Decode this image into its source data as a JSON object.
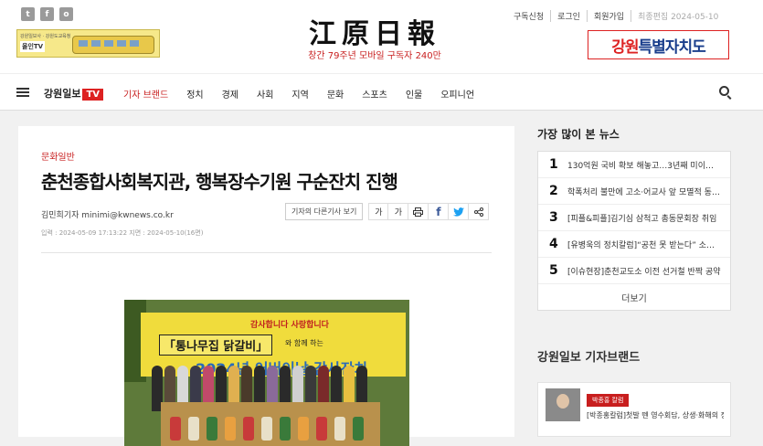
{
  "header": {
    "social": [
      "t",
      "f",
      "o"
    ],
    "logo": "江原日報",
    "tagline": "창간 79주년 모바일 구독자 240만",
    "util": {
      "subscribe": "구독신청",
      "login": "로그인",
      "join": "회원가입",
      "updated": "최종편집 2024-05-10"
    },
    "ad_left": {
      "small": "강원일보사 · 강원도교육청",
      "tag": "올인TV"
    },
    "ad_right": {
      "lead": "강원",
      "rest": "특별자치도"
    }
  },
  "nav": {
    "brand": "강원일보",
    "brand_tv": "TV",
    "items": [
      "기자 브랜드",
      "정치",
      "경제",
      "사회",
      "지역",
      "문화",
      "스포츠",
      "인물",
      "오피니언"
    ]
  },
  "article": {
    "section": "문화일반",
    "title": "춘천종합사회복지관, 행복장수기원 구순잔치 진행",
    "byline": "김민희기자 minimi@kwnews.co.kr",
    "other_articles": "기자의 다른기사 보기",
    "font_smaller": "가",
    "font_larger": "가",
    "meta": "입력 : 2024-05-09 17:13:22 지면 : 2024-05-10(16면)",
    "photo": {
      "banner_top": "감사합니다  사랑합니다",
      "banner_name": "「통나무집 닭갈비」",
      "banner_with": "와 함께 하는",
      "banner_year": "2024년 어버이날 감사잔치"
    }
  },
  "sidebar": {
    "popular_title": "가장 많이 본 뉴스",
    "popular": [
      {
        "rank": "1",
        "title": "130억원 국비 확보 해놓고…3년째 미이뤄진 사업"
      },
      {
        "rank": "2",
        "title": "학폭처리 불만에 고소·어교사 앞 모멸적 동영상"
      },
      {
        "rank": "3",
        "title": "[피플&피플]김기심 삼척고 총동문회장 취임"
      },
      {
        "rank": "4",
        "title": "[유병욱의 정치칼럼]“공천 못 받는다” 소문에"
      },
      {
        "rank": "5",
        "title": "[이슈현장]춘천교도소 이전 선거철 반짝 공약"
      }
    ],
    "more": "더보기",
    "brand_title": "강원일보 기자브랜드",
    "reporter": {
      "tag": "박종홍 칼럼",
      "headline": "[박종홍칼럼]첫발 뗀 영수회담, 상생·화해의 정치"
    }
  }
}
